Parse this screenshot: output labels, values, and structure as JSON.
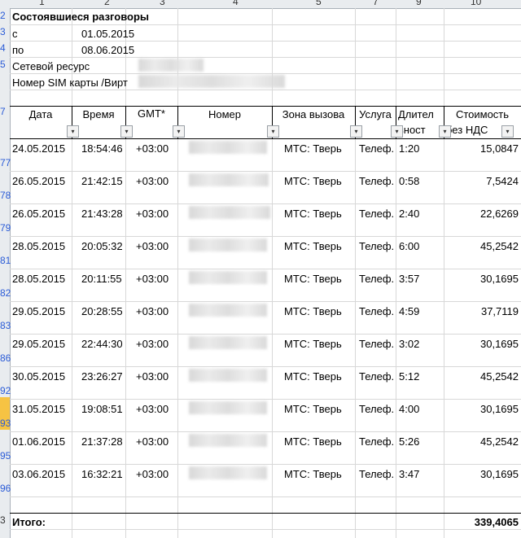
{
  "column_headers": [
    "1",
    "2",
    "3",
    "4",
    "5",
    "7",
    "9",
    "10"
  ],
  "row_headers": [
    "2",
    "3",
    "4",
    "5",
    "7",
    "77",
    "78",
    "79",
    "81",
    "82",
    "83",
    "86",
    "92",
    "93",
    "95",
    "96",
    "3"
  ],
  "info": {
    "title": "Состоявшиеся разговоры",
    "from_label": "с",
    "from_date": "01.05.2015",
    "to_label": "по",
    "to_date": "08.06.2015",
    "network_label": "Сетевой ресурс",
    "sim_label": "Номер SIM карты /Вирт"
  },
  "table_headers": {
    "date": "Дата",
    "time": "Время",
    "gmt": "GMT*",
    "number": "Номер",
    "zone": "Зона вызова",
    "service": "Услуга",
    "duration_line1": "Длител",
    "duration_line2": "ьност",
    "cost_line1": "Стоимость",
    "cost_line2": "без НДС"
  },
  "filter_icons": [
    "▾",
    "▾",
    "▾",
    "▾",
    "▾",
    "▾",
    "▾",
    "▾"
  ],
  "rows": [
    {
      "date": "24.05.2015",
      "time": "18:54:46",
      "gmt": "+03:00",
      "zone": "МТС: Тверь",
      "service": "Телеф.",
      "duration": "1:20",
      "cost": "15,0847"
    },
    {
      "date": "26.05.2015",
      "time": "21:42:15",
      "gmt": "+03:00",
      "zone": "МТС: Тверь",
      "service": "Телеф.",
      "duration": "0:58",
      "cost": "7,5424"
    },
    {
      "date": "26.05.2015",
      "time": "21:43:28",
      "gmt": "+03:00",
      "zone": "МТС: Тверь",
      "service": "Телеф.",
      "duration": "2:40",
      "cost": "22,6269"
    },
    {
      "date": "28.05.2015",
      "time": "20:05:32",
      "gmt": "+03:00",
      "zone": "МТС: Тверь",
      "service": "Телеф.",
      "duration": "6:00",
      "cost": "45,2542"
    },
    {
      "date": "28.05.2015",
      "time": "20:11:55",
      "gmt": "+03:00",
      "zone": "МТС: Тверь",
      "service": "Телеф.",
      "duration": "3:57",
      "cost": "30,1695"
    },
    {
      "date": "29.05.2015",
      "time": "20:28:55",
      "gmt": "+03:00",
      "zone": "МТС: Тверь",
      "service": "Телеф.",
      "duration": "4:59",
      "cost": "37,7119"
    },
    {
      "date": "29.05.2015",
      "time": "22:44:30",
      "gmt": "+03:00",
      "zone": "МТС: Тверь",
      "service": "Телеф.",
      "duration": "3:02",
      "cost": "30,1695"
    },
    {
      "date": "30.05.2015",
      "time": "23:26:27",
      "gmt": "+03:00",
      "zone": "МТС: Тверь",
      "service": "Телеф.",
      "duration": "5:12",
      "cost": "45,2542"
    },
    {
      "date": "31.05.2015",
      "time": "19:08:51",
      "gmt": "+03:00",
      "zone": "МТС: Тверь",
      "service": "Телеф.",
      "duration": "4:00",
      "cost": "30,1695"
    },
    {
      "date": "01.06.2015",
      "time": "21:37:28",
      "gmt": "+03:00",
      "zone": "МТС: Тверь",
      "service": "Телеф.",
      "duration": "5:26",
      "cost": "45,2542"
    },
    {
      "date": "03.06.2015",
      "time": "16:32:21",
      "gmt": "+03:00",
      "zone": "МТС: Тверь",
      "service": "Телеф.",
      "duration": "3:47",
      "cost": "30,1695"
    }
  ],
  "total": {
    "label": "Итого:",
    "value": "339,4065"
  }
}
